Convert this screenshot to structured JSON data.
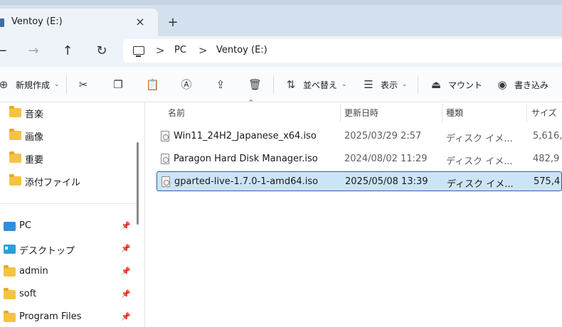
{
  "tab": {
    "title": "Ventoy (E:)",
    "close": "×",
    "new_tab": "+"
  },
  "nav": {
    "back": "←",
    "forward": "→",
    "up": "↑",
    "refresh": "↻"
  },
  "breadcrumb": {
    "sep": ">",
    "items": [
      "PC",
      "Ventoy (E:)"
    ]
  },
  "commands": {
    "new": "新規作成",
    "sort": "並べ替え",
    "view": "表示",
    "mount": "マウント",
    "burn": "書き込み"
  },
  "sidebar": {
    "top_items": [
      "音楽",
      "画像",
      "重要",
      "添付ファイル"
    ],
    "pinned_items": [
      "PC",
      "デスクトップ",
      "admin",
      "soft",
      "Program Files"
    ]
  },
  "columns": {
    "name": "名前",
    "date": "更新日時",
    "type": "種類",
    "size": "サイズ"
  },
  "files": [
    {
      "name": "Win11_24H2_Japanese_x64.iso",
      "date": "2025/03/29 2:57",
      "type": "ディスク イメ...",
      "size": "5,616,",
      "selected": false
    },
    {
      "name": "Paragon Hard Disk Manager.iso",
      "date": "2024/08/02 11:29",
      "type": "ディスク イメ...",
      "size": "482,9",
      "selected": false
    },
    {
      "name": "gparted-live-1.7.0-1-amd64.iso",
      "date": "2025/05/08 13:39",
      "type": "ディスク イメ...",
      "size": "575,4",
      "selected": true
    }
  ],
  "colors": {
    "accent": "#2b5fa3",
    "selection": "#cce4f7",
    "folder": "#f5c343",
    "chrome": "#eef3f9"
  }
}
